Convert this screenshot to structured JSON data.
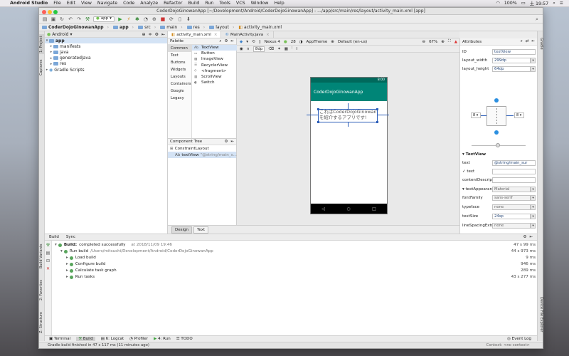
{
  "menubar": {
    "app_name": "Android Studio",
    "items": [
      "File",
      "Edit",
      "View",
      "Navigate",
      "Code",
      "Analyze",
      "Refactor",
      "Build",
      "Run",
      "Tools",
      "VCS",
      "Window",
      "Help"
    ],
    "battery": "100%",
    "clock": "土 19:57"
  },
  "window": {
    "title": "CoderDojoGinowanApp [~/Development/Android/CoderDojoGinowanApp] - .../app/src/main/res/layout/activity_main.xml [app]"
  },
  "toolbar": {
    "run_config": "app"
  },
  "navbar": {
    "crumbs": [
      "CoderDojoGinowanApp",
      "app",
      "src",
      "main",
      "res",
      "layout",
      "activity_main.xml"
    ]
  },
  "project": {
    "view_selector": "Android",
    "tree": [
      "app",
      "manifests",
      "java",
      "generatedJava",
      "res",
      "Gradle Scripts"
    ]
  },
  "editor": {
    "tabs": [
      "activity_main.xml",
      "MainActivity.java"
    ]
  },
  "palette": {
    "title": "Palette",
    "categories": [
      "Common",
      "Text",
      "Buttons",
      "Widgets",
      "Layouts",
      "Containers",
      "Google",
      "Legacy"
    ],
    "items": [
      {
        "label": "TextView",
        "icon": "Ab"
      },
      {
        "label": "Button",
        "icon": ""
      },
      {
        "label": "ImageView",
        "icon": ""
      },
      {
        "label": "RecyclerView",
        "icon": ""
      },
      {
        "label": "<fragment>",
        "icon": ""
      },
      {
        "label": "ScrollView",
        "icon": ""
      },
      {
        "label": "Switch",
        "icon": ""
      }
    ]
  },
  "component_tree": {
    "title": "Component Tree",
    "root": "ConstraintLayout",
    "child_icon": "Ab",
    "child_label": "textView",
    "child_hint": "\"@string/main_s...\""
  },
  "design_toolbar": {
    "device": "Nexus 4",
    "api": "28",
    "theme": "AppTheme",
    "locale": "Default (en-us)",
    "zoom": "67%",
    "margin": "8dp"
  },
  "design_tabs": [
    "Design",
    "Text"
  ],
  "phone": {
    "time": "8:00",
    "app_title": "CoderDojoGinowanApp",
    "text_line1": "これはCoderDojoGinowan",
    "text_line2": "を紹介するアプリです!"
  },
  "attributes": {
    "title": "Attributes",
    "id_label": "ID",
    "id_value": "textView",
    "layout_width_label": "layout_width",
    "layout_width_value": "299dp",
    "layout_height_label": "layout_height",
    "layout_height_value": "64dp",
    "margin_left": "8",
    "margin_right": "8",
    "section_title": "TextView",
    "rows": [
      {
        "label": "text",
        "value": "@string/main_sur"
      },
      {
        "label": "✓ text",
        "value": ""
      },
      {
        "label": "contentDescrip",
        "value": ""
      },
      {
        "label": "▾ textAppearan",
        "value": "Material"
      },
      {
        "label": "fontFamily",
        "value": "sans-serif"
      },
      {
        "label": "typeface",
        "value": "none"
      },
      {
        "label": "textSize",
        "value": "24sp"
      },
      {
        "label": "lineSpacingExtr",
        "value": "none"
      }
    ]
  },
  "build": {
    "tabs": [
      "Build",
      "Sync"
    ],
    "rows": [
      {
        "label": "Build:",
        "detail": "completed successfully",
        "when": "at 2018/11/09 19:46",
        "time": "47 s 99 ms"
      },
      {
        "label": "Run build",
        "detail": "/Users/mitsushi/Development/Android/CoderDojoGinowanApp",
        "when": "",
        "time": "44 s 973 ms"
      },
      {
        "label": "Load build",
        "detail": "",
        "when": "",
        "time": "9 ms"
      },
      {
        "label": "Configure build",
        "detail": "",
        "when": "",
        "time": "946 ms"
      },
      {
        "label": "Calculate task graph",
        "detail": "",
        "when": "",
        "time": "289 ms"
      },
      {
        "label": "Run tasks",
        "detail": "",
        "when": "",
        "time": "43 s 277 ms"
      }
    ]
  },
  "left_stripe": [
    "1: Project",
    "Captures",
    "Build Variants",
    "2: Favorites",
    "Z: Structure"
  ],
  "right_stripe": [
    "Gradle",
    "Device File Explorer"
  ],
  "bottom_tabs": [
    "Terminal",
    "Build",
    "6: Logcat",
    "Profiler",
    "4: Run",
    "TODO"
  ],
  "event_log": "Event Log",
  "status": {
    "message": "Gradle build finished in 47 s 117 ms (11 minutes ago)",
    "context": "Context: <no context>"
  }
}
